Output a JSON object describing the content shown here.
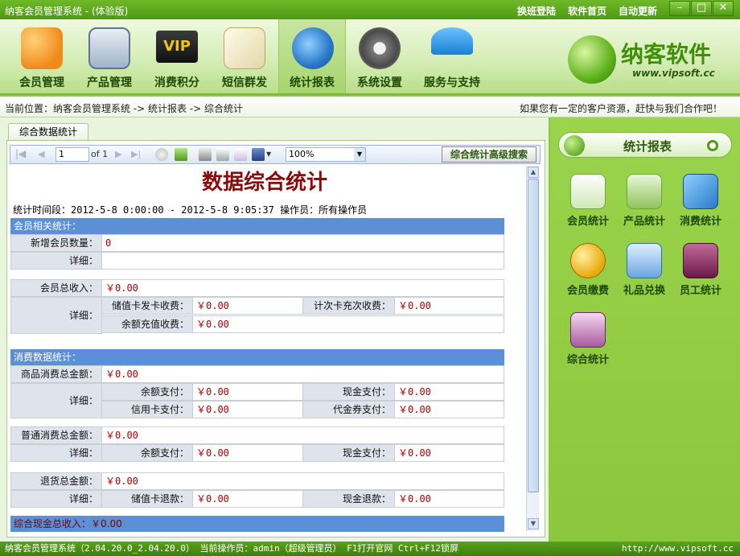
{
  "window": {
    "title": "纳客会员管理系统 - (体验版)",
    "links": [
      "换班登陆",
      "软件首页",
      "自动更新"
    ],
    "min": "–",
    "max": "□",
    "close": "✕"
  },
  "toolbar": {
    "items": [
      {
        "label": "会员管理",
        "icon": "members-icon"
      },
      {
        "label": "产品管理",
        "icon": "product-icon"
      },
      {
        "label": "消费积分",
        "icon": "vip-icon"
      },
      {
        "label": "短信群发",
        "icon": "sms-icon"
      },
      {
        "label": "统计报表",
        "icon": "report-clock-icon"
      },
      {
        "label": "系统设置",
        "icon": "gear-icon"
      },
      {
        "label": "服务与支持",
        "icon": "umbrella-icon"
      }
    ],
    "active": "统计报表"
  },
  "logo": {
    "name": "纳客软件",
    "url": "www.vipsoft.cc"
  },
  "breadcrumb": {
    "left": "当前位置：纳客会员管理系统 -> 统计报表 -> 综合统计",
    "right": "如果您有一定的客户资源，赶快与我们合作吧！"
  },
  "tab": {
    "label": "综合数据统计"
  },
  "report_toolbar": {
    "page": "1",
    "of": "of 1",
    "zoom": "100%",
    "advanced_search": "综合统计高级搜索"
  },
  "report": {
    "title": "数据综合统计",
    "time_line": "统计时间段：2012-5-8 0:00:00 - 2012-5-8 9:05:37 操作员：所有操作员",
    "member_section": "会员相关统计：",
    "new_members_label": "新增会员数量：",
    "new_members_value": "0",
    "detail_label": "详细：",
    "member_income_label": "会员总收入：",
    "member_income_value": "￥0.00",
    "stored_card_fee_label": "储值卡发卡收费：",
    "stored_card_fee_value": "￥0.00",
    "count_card_fee_label": "计次卡充次收费：",
    "count_card_fee_value": "￥0.00",
    "balance_topup_label": "余额充值收费：",
    "balance_topup_value": "￥0.00",
    "consume_section": "消费数据统计：",
    "goods_total_label": "商品消费总金额：",
    "goods_total_value": "￥0.00",
    "balance_pay_label": "余额支付：",
    "balance_pay_value": "￥0.00",
    "cash_pay_label": "现金支付：",
    "cash_pay_value": "￥0.00",
    "credit_pay_label": "信用卡支付：",
    "credit_pay_value": "￥0.00",
    "voucher_pay_label": "代金券支付：",
    "voucher_pay_value": "￥0.00",
    "normal_total_label": "普通消费总金额：",
    "normal_total_value": "￥0.00",
    "normal_balance_value": "￥0.00",
    "normal_cash_value": "￥0.00",
    "return_total_label": "退货总金额：",
    "return_total_value": "￥0.00",
    "stored_refund_label": "储值卡退款：",
    "stored_refund_value": "￥0.00",
    "cash_refund_label": "现金退款：",
    "cash_refund_value": "￥0.00",
    "grand_total": "综合现金总收入：￥0.00"
  },
  "side": {
    "title": "统计报表",
    "items": [
      {
        "label": "会员统计",
        "icon": "member-stat-icon"
      },
      {
        "label": "产品统计",
        "icon": "product-stat-icon"
      },
      {
        "label": "消费统计",
        "icon": "consume-stat-icon"
      },
      {
        "label": "会员缴费",
        "icon": "coin-icon"
      },
      {
        "label": "礼品兑换",
        "icon": "gift-icon"
      },
      {
        "label": "员工统计",
        "icon": "staff-icon"
      },
      {
        "label": "综合统计",
        "icon": "summary-stat-icon"
      }
    ]
  },
  "status": {
    "left": "纳客会员管理系统（2.04.20.0_2.04.20.0） 当前操作员：admin（超级管理员） F1打开官网 Ctrl+F12锁屏",
    "right": "http://www.vipsoft.cc"
  }
}
